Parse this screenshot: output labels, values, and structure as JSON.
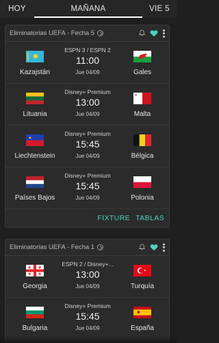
{
  "tabs": [
    {
      "label": "HOY"
    },
    {
      "label": "MAÑANA"
    },
    {
      "label": "VIE 5"
    }
  ],
  "cards": [
    {
      "title": "Eliminatorias UEFA - Fecha 5",
      "matches": [
        {
          "home": "Kazajstán",
          "away": "Gales",
          "channel": "ESPN 3 / ESPN 2",
          "time": "11:00",
          "date": "Jue 04/09"
        },
        {
          "home": "Lituania",
          "away": "Malta",
          "channel": "Disney+ Premium",
          "time": "13:00",
          "date": "Jue 04/09"
        },
        {
          "home": "Liechtenstein",
          "away": "Bélgica",
          "channel": "Disney+ Premium",
          "time": "15:45",
          "date": "Jue 04/09"
        },
        {
          "home": "Países Bajos",
          "away": "Polonia",
          "channel": "Disney+ Premium",
          "time": "15:45",
          "date": "Jue 04/09"
        }
      ],
      "footer": {
        "fixture": "FIXTURE",
        "tablas": "TABLAS"
      }
    },
    {
      "title": "Eliminatorias UEFA - Fecha 1",
      "matches": [
        {
          "home": "Georgia",
          "away": "Turquía",
          "channel": "ESPN 2 / Disney+...",
          "time": "13:00",
          "date": "Jue 04/09"
        },
        {
          "home": "Bulgaria",
          "away": "España",
          "channel": "Disney+ Premium",
          "time": "15:45",
          "date": "Jue 04/09"
        }
      ]
    }
  ],
  "colors": {
    "accent": "#4fd1c5",
    "background": "#1f1f1f",
    "card": "#2b2b2b"
  },
  "icons": [
    "chevron-right-icon",
    "bell-icon",
    "heart-icon",
    "more-vert-icon"
  ]
}
